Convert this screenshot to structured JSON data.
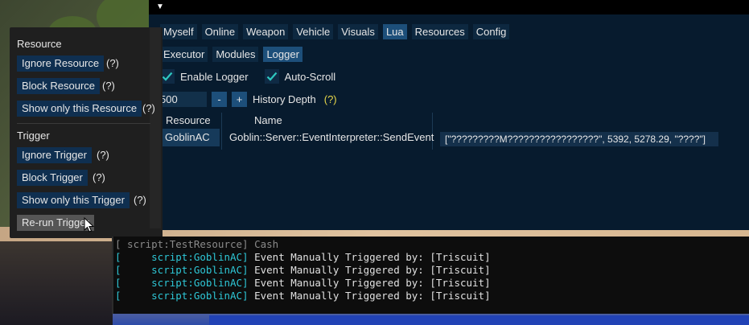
{
  "main_tabs": [
    "Myself",
    "Online",
    "Weapon",
    "Vehicle",
    "Visuals",
    "Lua",
    "Resources",
    "Config"
  ],
  "main_tab_active": "Lua",
  "sub_tabs": [
    "Executor",
    "Modules",
    "Logger"
  ],
  "sub_tab_active": "Logger",
  "options": {
    "enable_logger_label": "Enable Logger",
    "enable_logger_checked": true,
    "auto_scroll_label": "Auto-Scroll",
    "auto_scroll_checked": true,
    "history_depth_value": "500",
    "minus_label": "-",
    "plus_label": "+",
    "history_depth_label": "History Depth",
    "history_help": "(?)"
  },
  "table": {
    "headers": [
      "Resource",
      "Name"
    ],
    "row": {
      "resource": "GoblinAC",
      "name": "Goblin::Server::EventInterpreter::SendEvent",
      "args": "[\"?????????M?????????????????\", 5392, 5278.29, \"????\"]"
    }
  },
  "popup": {
    "resource_header": "Resource",
    "ignore_resource": "Ignore Resource",
    "block_resource": "Block Resource",
    "show_only_resource": "Show only this Resource",
    "trigger_header": "Trigger",
    "ignore_trigger": "Ignore Trigger",
    "block_trigger": "Block Trigger",
    "show_only_trigger": "Show only this Trigger",
    "rerun_trigger": "Re-run Trigger",
    "help": "(?)"
  },
  "console": {
    "partial_line": "[ script:TestResource] Cash",
    "lines": [
      {
        "bracket": "[",
        "source": "     script:GoblinAC]",
        "text": " Event Manually Triggered by: [Triscuit]"
      },
      {
        "bracket": "[",
        "source": "     script:GoblinAC]",
        "text": " Event Manually Triggered by: [Triscuit]"
      },
      {
        "bracket": "[",
        "source": "     script:GoblinAC]",
        "text": " Event Manually Triggered by: [Triscuit]"
      },
      {
        "bracket": "[",
        "source": "     script:GoblinAC]",
        "text": " Event Manually Triggered by: [Triscuit]"
      }
    ]
  },
  "colors": {
    "window_bg": "#071b2e",
    "tab_active": "#1d4f7a",
    "accent_check": "#2ec7c0",
    "help_yellow": "#e8d84a",
    "console_cyan": "#2ec7d6"
  }
}
